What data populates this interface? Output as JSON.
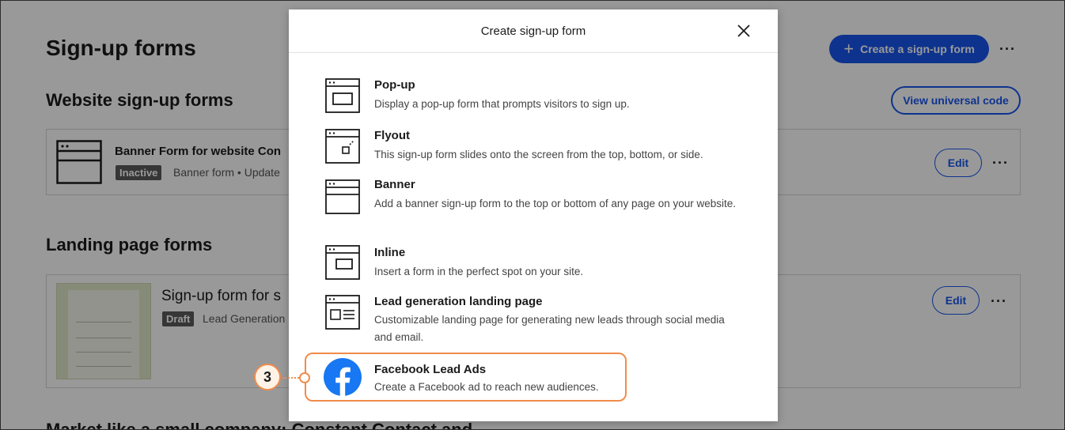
{
  "page": {
    "title": "Sign-up forms",
    "create_button": "Create a sign-up form",
    "website_section": {
      "title": "Website sign-up forms",
      "view_code_button": "View universal code",
      "card": {
        "title": "Banner Form for website Con",
        "status": "Inactive",
        "meta": "Banner form • Update",
        "edit": "Edit"
      }
    },
    "landing_section": {
      "title": "Landing page forms",
      "card": {
        "title": "Sign-up form for s",
        "status": "Draft",
        "meta": "Lead Generation",
        "edit": "Edit"
      }
    },
    "bottom_partial": "Market like a small company: Constant Contact and..."
  },
  "modal": {
    "title": "Create sign-up form",
    "options": [
      {
        "icon": "popup-form-icon",
        "title": "Pop-up",
        "desc": "Display a pop-up form that prompts visitors to sign up."
      },
      {
        "icon": "flyout-form-icon",
        "title": "Flyout",
        "desc": "This sign-up form slides onto the screen from the top, bottom, or side."
      },
      {
        "icon": "banner-form-icon",
        "title": "Banner",
        "desc": "Add a banner sign-up form to the top or bottom of any page on your website."
      },
      {
        "icon": "inline-form-icon",
        "title": "Inline",
        "desc": "Insert a form in the perfect spot on your site."
      },
      {
        "icon": "landing-page-icon",
        "title": "Lead generation landing page",
        "desc": "Customizable landing page for generating new leads through social media and email."
      },
      {
        "icon": "facebook-icon",
        "title": "Facebook Lead Ads",
        "desc": "Create a Facebook ad to reach new audiences."
      }
    ]
  },
  "callout": {
    "number": "3"
  },
  "colors": {
    "primary": "#1856ed",
    "highlight": "#f08c4b",
    "facebook": "#1877f2"
  }
}
